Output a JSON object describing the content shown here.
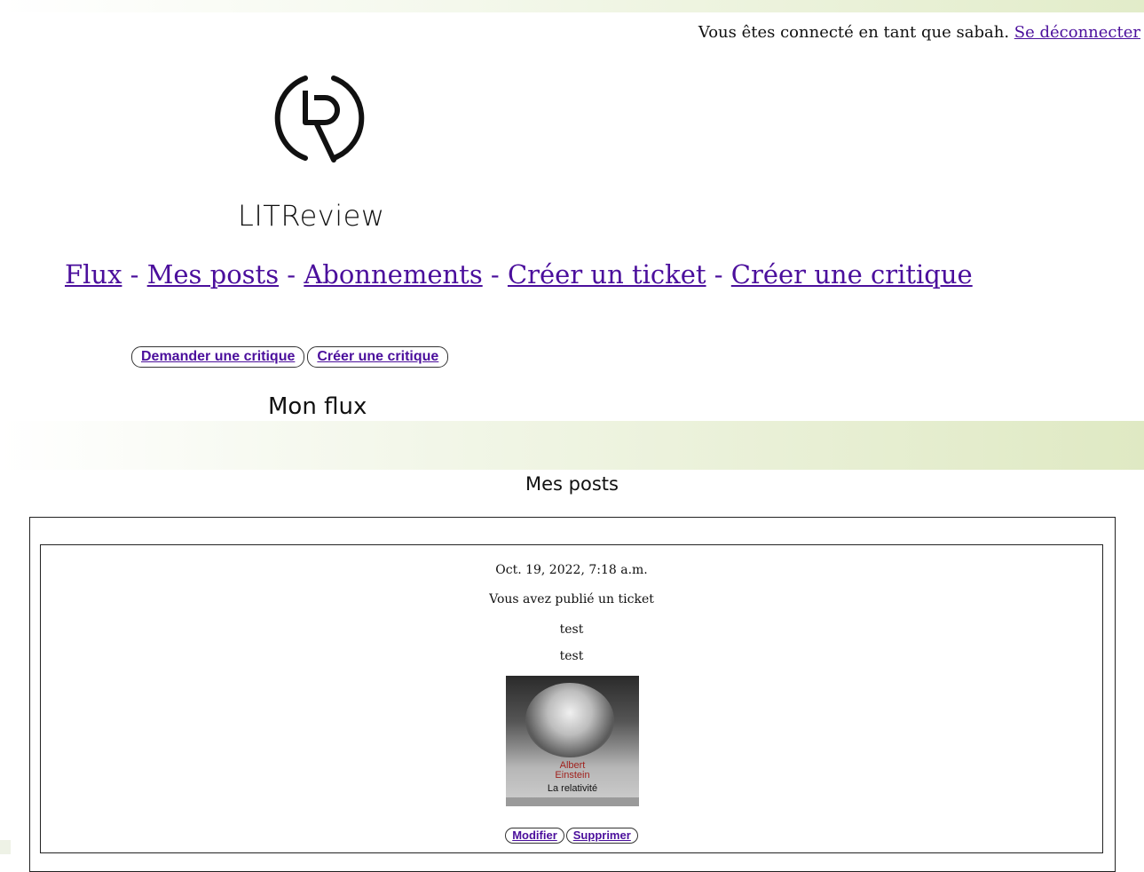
{
  "header": {
    "status_text": "Vous êtes connecté en tant que sabah.",
    "logout_label": "Se déconnecter",
    "brand": "LITReview"
  },
  "nav": {
    "items": [
      {
        "label": "Flux"
      },
      {
        "label": "Mes posts"
      },
      {
        "label": "Abonnements"
      },
      {
        "label": "Créer un ticket"
      },
      {
        "label": "Créer une critique"
      }
    ],
    "separator": " - "
  },
  "actions": {
    "request_review": "Demander une critique",
    "create_review": "Créer une critique"
  },
  "flux_title": "Mon flux",
  "posts_title": "Mes posts",
  "post": {
    "date": "Oct. 19, 2022, 7:18 a.m.",
    "caption": "Vous avez publié un ticket",
    "title": "test",
    "description": "test",
    "cover": {
      "author_line1": "Albert",
      "author_line2": "Einstein",
      "book_title": "La relativité"
    },
    "edit_label": "Modifier",
    "delete_label": "Supprimer"
  },
  "colors": {
    "link": "#4b0f9c",
    "band_green": "#dfe9c3"
  }
}
